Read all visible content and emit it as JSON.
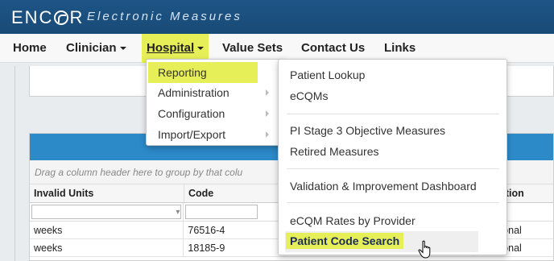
{
  "header": {
    "logo_text": [
      "ENC",
      "R"
    ],
    "tagline": "Electronic Measures",
    "bar_color": "#1e5586"
  },
  "nav": {
    "items": [
      {
        "label": "Home"
      },
      {
        "label": "Clinician"
      },
      {
        "label": "Hospital"
      },
      {
        "label": "Value Sets"
      },
      {
        "label": "Contact Us"
      },
      {
        "label": "Links"
      }
    ],
    "highlight_color": "#e6ef58"
  },
  "hospital_menu": {
    "items": [
      {
        "label": "Reporting",
        "has_submenu": false,
        "highlighted": true
      },
      {
        "label": "Administration",
        "has_submenu": true
      },
      {
        "label": "Configuration",
        "has_submenu": true
      },
      {
        "label": "Import/Export",
        "has_submenu": true
      }
    ]
  },
  "reporting_menu": {
    "items": [
      {
        "label": "Patient Lookup"
      },
      {
        "label": "eCQMs"
      },
      {
        "label": "PI Stage 3 Objective Measures"
      },
      {
        "label": "Retired Measures"
      },
      {
        "label": "Validation & Improvement Dashboard"
      },
      {
        "label": "eCQM Rates by Provider"
      },
      {
        "label": "Patient Code Search"
      }
    ]
  },
  "grid": {
    "group_hint": "Drag a column header here to group by that colu",
    "columns": [
      "Invalid Units",
      "Code",
      "escription"
    ],
    "rows": [
      [
        "weeks",
        "76516-4",
        "estational"
      ],
      [
        "weeks",
        "18185-9",
        "estational"
      ]
    ],
    "header_color": "#2c8ac9"
  }
}
